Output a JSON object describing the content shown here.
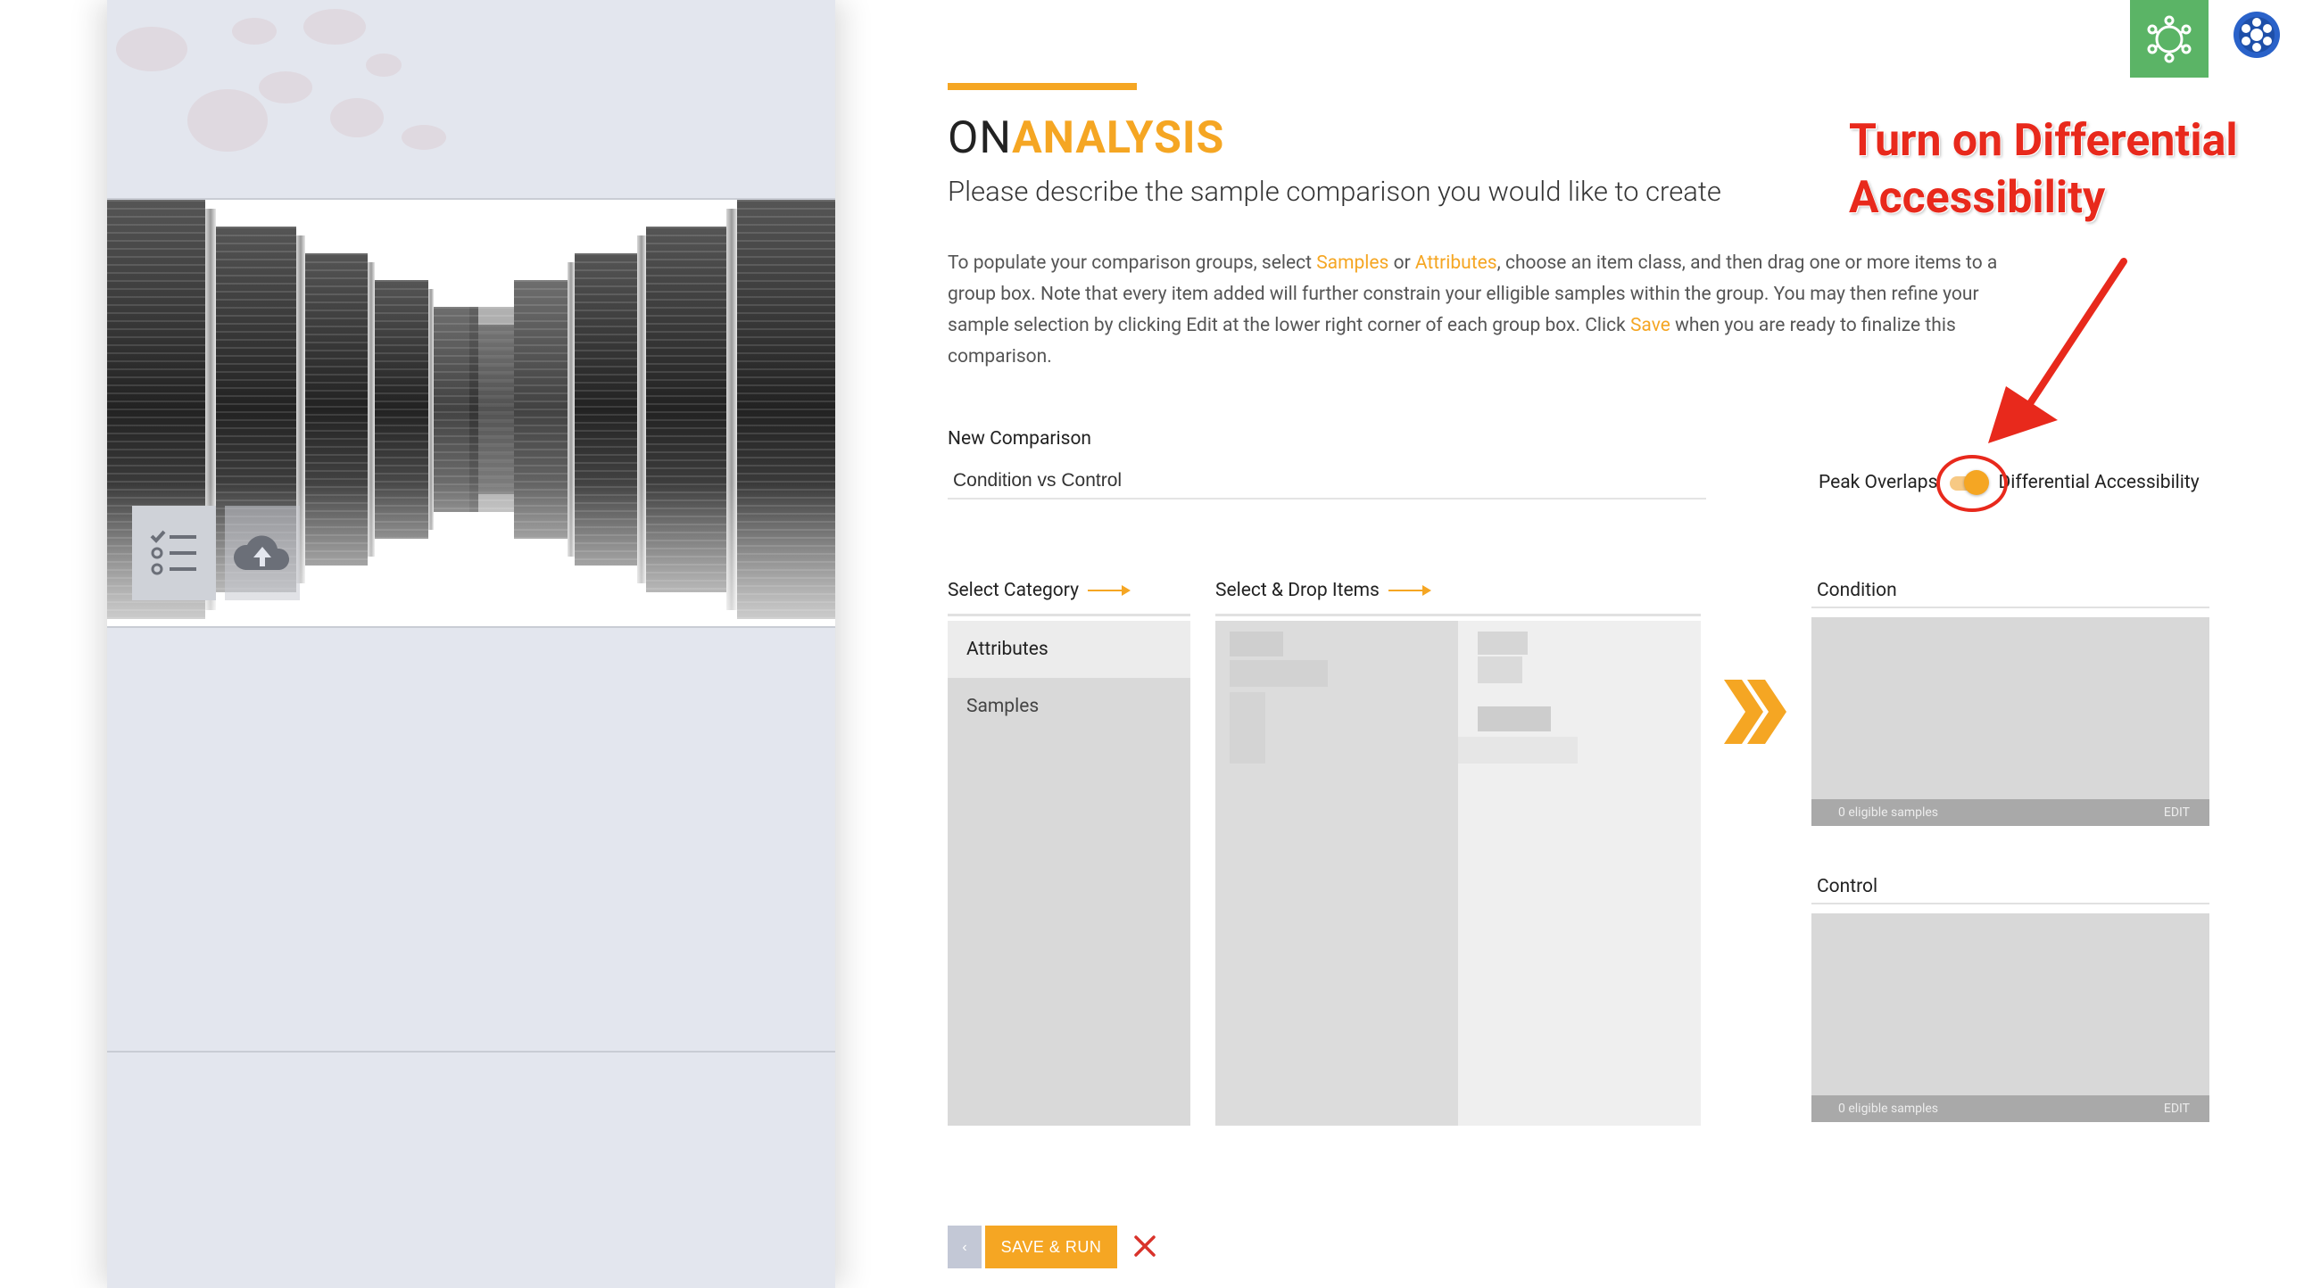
{
  "app": {
    "title_part1": "ON",
    "title_part2": "ANALYSIS",
    "subtitle": "Please describe the sample comparison you would like to create",
    "accent": "#f5a623"
  },
  "instructions": {
    "p1": "To populate your comparison groups, select ",
    "link_samples": "Samples",
    "p2": " or ",
    "link_attributes": "Attributes",
    "p3": ", choose an item class, and then drag one or more items to a group box. Note that every item added will further constrain your elligible samples within the group. You may then refine your sample selection by clicking Edit at the lower right corner of each group box. Click ",
    "link_save": "Save",
    "p4": " when you are ready to finalize this comparison."
  },
  "comparison": {
    "label": "New Comparison",
    "value": "Condition vs Control"
  },
  "toggle": {
    "left_label": "Peak Overlaps",
    "right_label": "Differential Accessibility",
    "state": "on"
  },
  "annotation": {
    "line1": "Turn on Differential",
    "line2": "Accessibility",
    "color": "#e8291c"
  },
  "columns": {
    "category_label": "Select Category",
    "items_label": "Select & Drop Items"
  },
  "categories": [
    {
      "label": "Attributes"
    },
    {
      "label": "Samples"
    }
  ],
  "groups": [
    {
      "label": "Condition",
      "count": "0 eligible samples",
      "edit": "EDIT"
    },
    {
      "label": "Control",
      "count": "0 eligible samples",
      "edit": "EDIT"
    }
  ],
  "footer": {
    "back_label": "‹",
    "save_label": "SAVE & RUN",
    "close_color": "#d9332b"
  },
  "icons": {
    "settings": "network-gear-icon",
    "logo": "brand-logo-icon",
    "list": "checklist-icon",
    "upload": "cloud-upload-icon",
    "forward": "double-chevron-right-icon"
  }
}
